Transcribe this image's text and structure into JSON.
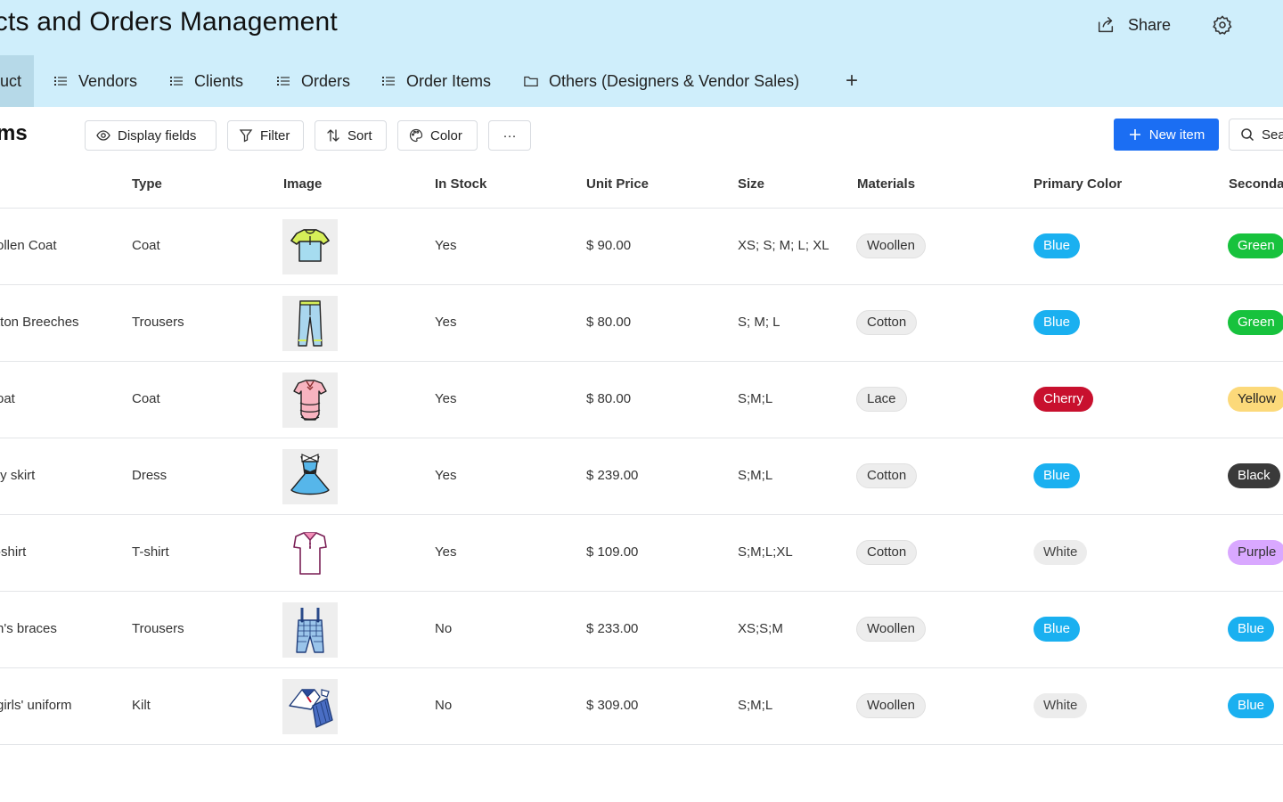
{
  "header": {
    "title": "ducts and Orders Management",
    "share_label": "Share"
  },
  "tabs": [
    {
      "label": "uct",
      "icon": "table-icon",
      "active": true
    },
    {
      "label": "Vendors",
      "icon": "list-icon"
    },
    {
      "label": "Clients",
      "icon": "list-icon"
    },
    {
      "label": "Orders",
      "icon": "list-icon"
    },
    {
      "label": "Order Items",
      "icon": "list-icon"
    },
    {
      "label": "Others (Designers & Vendor Sales)",
      "icon": "folder-icon"
    }
  ],
  "tab_add_label": "+",
  "toolbar": {
    "view_title": "ms",
    "display_fields": "Display fields",
    "filter": "Filter",
    "sort": "Sort",
    "color": "Color",
    "more": "···",
    "new_item": "New item",
    "search_placeholder": "Sea"
  },
  "columns": [
    "Type",
    "Image",
    "In Stock",
    "Unit Price",
    "Size",
    "Materials",
    "Primary Color",
    "Seconda"
  ],
  "colors": {
    "accent": "#1b6ef3",
    "header_bg": "#cfeefb",
    "Blue": "#1ab0f0",
    "Green": "#17c23d",
    "Cherry": "#c8102e",
    "Yellow": "#fcd97a",
    "Black": "#3a3a3a",
    "White": "#ececec",
    "Purple": "#d9a8ff"
  },
  "rows": [
    {
      "name": "ollen Coat",
      "type": "Coat",
      "image": "tshirt-image",
      "in_stock": "Yes",
      "price": "$ 90.00",
      "size": "XS; S; M; L; XL",
      "material": "Woollen",
      "primary": "Blue",
      "secondary": "Green"
    },
    {
      "name": "tton Breeches",
      "type": "Trousers",
      "image": "jeans-image",
      "in_stock": "Yes",
      "price": "$ 80.00",
      "size": "S; M; L",
      "material": "Cotton",
      "primary": "Blue",
      "secondary": "Green"
    },
    {
      "name": "oat",
      "type": "Coat",
      "image": "frilly-dress-image",
      "in_stock": "Yes",
      "price": "$ 80.00",
      "size": "S;M;L",
      "material": "Lace",
      "primary": "Cherry",
      "secondary": "Yellow"
    },
    {
      "name": "ty skirt",
      "type": "Dress",
      "image": "blue-dress-image",
      "in_stock": "Yes",
      "price": "$ 239.00",
      "size": "S;M;L",
      "material": "Cotton",
      "primary": "Blue",
      "secondary": "Black"
    },
    {
      "name": "-shirt",
      "type": "T-shirt",
      "image": "polo-shirt-image",
      "in_stock": "Yes",
      "price": "$ 109.00",
      "size": "S;M;L;XL",
      "material": "Cotton",
      "primary": "White",
      "secondary": "Purple"
    },
    {
      "name": "n's braces",
      "type": "Trousers",
      "image": "overalls-image",
      "in_stock": "No",
      "price": "$ 233.00",
      "size": "XS;S;M",
      "material": "Woollen",
      "primary": "Blue",
      "secondary": "Blue"
    },
    {
      "name": "girls' uniform",
      "type": "Kilt",
      "image": "uniform-image",
      "in_stock": "No",
      "price": "$ 309.00",
      "size": "S;M;L",
      "material": "Woollen",
      "primary": "White",
      "secondary": "Blue"
    }
  ]
}
